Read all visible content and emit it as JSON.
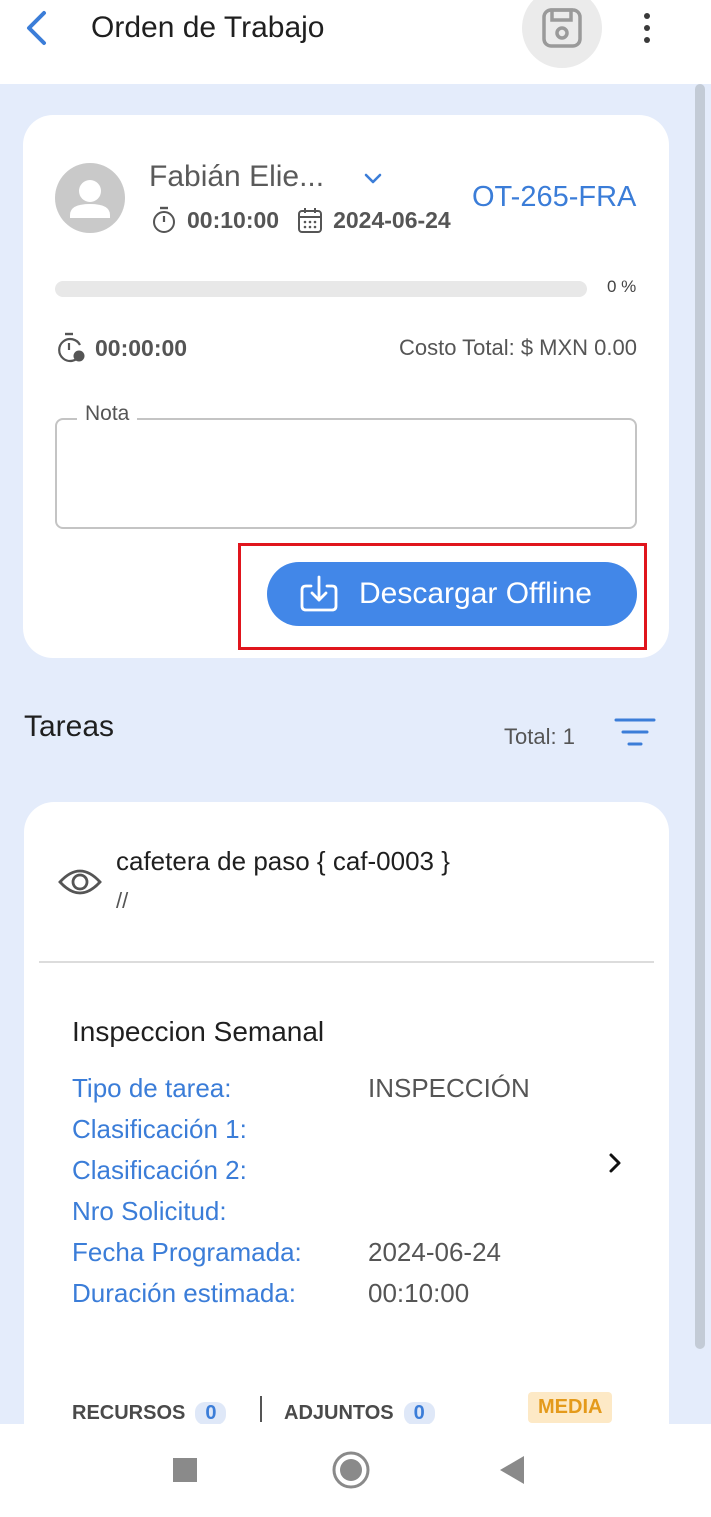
{
  "header": {
    "title": "Orden de Trabajo",
    "back_icon": "chevron-left-icon",
    "save_icon": "save-icon",
    "more_icon": "more-vert-icon"
  },
  "order": {
    "assignee": "Fabián Elie...",
    "duration": "00:10:00",
    "date": "2024-06-24",
    "code": "OT-265-FRA",
    "progress_percent": 0,
    "progress_label": "0 %",
    "elapsed_time": "00:00:00",
    "total_cost": "Costo Total: $ MXN 0.00",
    "note_label": "Nota",
    "note_value": "",
    "download_button": "Descargar Offline"
  },
  "tasks": {
    "title": "Tareas",
    "total": "Total: 1",
    "items": [
      {
        "asset": "cafetera de paso { caf-0003 }",
        "asset_sub": "//",
        "name": "Inspeccion Semanal",
        "fields": [
          {
            "label": "Tipo de tarea:",
            "value": "INSPECCIÓN"
          },
          {
            "label": "Clasificación 1:",
            "value": ""
          },
          {
            "label": "Clasificación 2:",
            "value": ""
          },
          {
            "label": "Nro Solicitud:",
            "value": ""
          },
          {
            "label": "Fecha Programada:",
            "value": "2024-06-24"
          },
          {
            "label": "Duración estimada:",
            "value": "00:10:00"
          }
        ],
        "footer": {
          "resources_label": "RECURSOS",
          "resources_count": "0",
          "attachments_label": "ADJUNTOS",
          "attachments_count": "0",
          "priority": "MEDIA"
        }
      }
    ]
  },
  "colors": {
    "accent": "#3b7dd8",
    "button": "#4287e8",
    "background": "#e4ecfb",
    "highlight": "#e0151d",
    "priority": "#e49a1b"
  },
  "navbar": {
    "icons": [
      "recents-square-icon",
      "home-circle-icon",
      "back-triangle-icon"
    ]
  }
}
